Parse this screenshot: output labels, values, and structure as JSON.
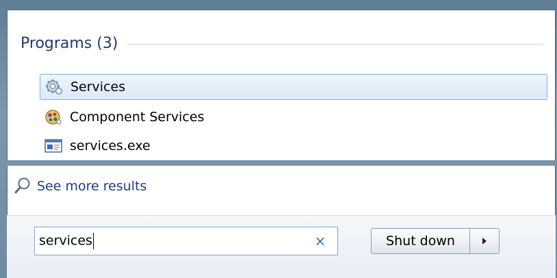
{
  "section": {
    "title": "Programs (3)"
  },
  "results": [
    {
      "label": "Services",
      "icon": "services-gear-icon",
      "selected": true
    },
    {
      "label": "Component Services",
      "icon": "component-services-icon",
      "selected": false
    },
    {
      "label": "services.exe",
      "icon": "exe-window-icon",
      "selected": false
    }
  ],
  "see_more": {
    "label": "See more results",
    "icon": "magnifier-icon"
  },
  "search": {
    "value": "services",
    "clear_icon": "clear-x-icon",
    "clear_glyph": "×"
  },
  "shutdown": {
    "label": "Shut down",
    "arrow_icon": "right-arrow-icon"
  },
  "colors": {
    "link": "#1a3c8a",
    "header": "#1e3a6e",
    "selection_border": "#84acd6"
  }
}
